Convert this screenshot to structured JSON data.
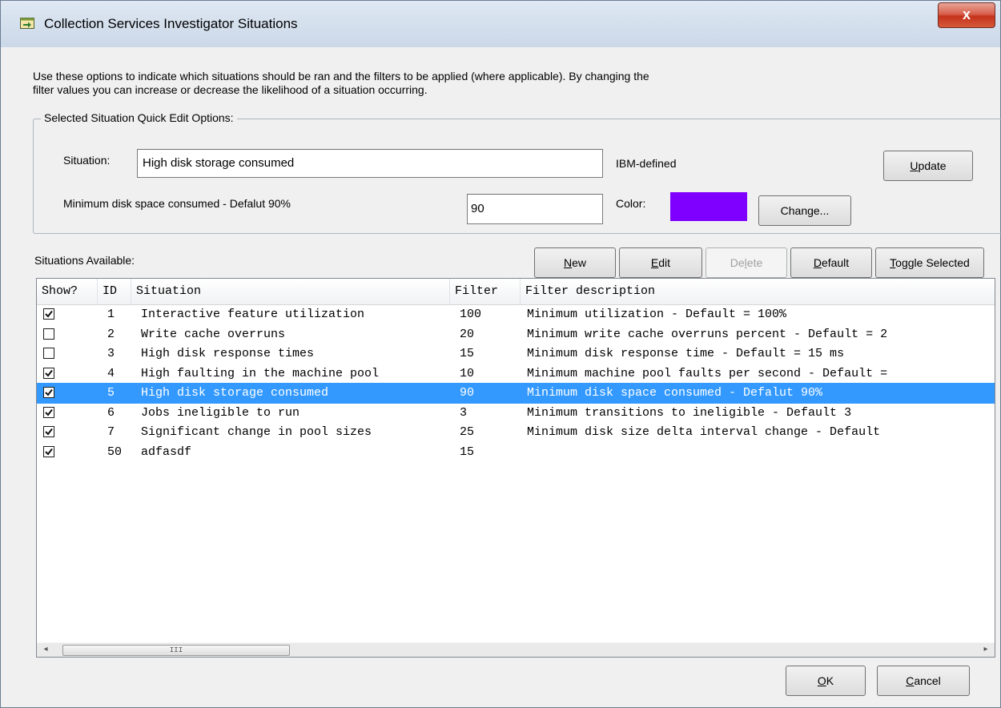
{
  "window": {
    "title": "Collection Services Investigator Situations",
    "close_label": "x"
  },
  "description_lines": [
    "Use these options to indicate which situations should be ran and the filters to be applied (where applicable).  By changing the",
    "filter values you can increase or decrease the likelihood of a situation occurring."
  ],
  "quick_edit": {
    "legend": "Selected Situation Quick Edit Options:",
    "situation_label": "Situation:",
    "situation_value": "High disk storage consumed",
    "defined_by": "IBM-defined",
    "update": {
      "pre": "",
      "accel": "U",
      "post": "pdate"
    },
    "filter_label": "Minimum disk space consumed - Defalut 90%",
    "filter_value": "90",
    "color_label": "Color:",
    "color_value": "#8000ff",
    "change_label": "Change..."
  },
  "list": {
    "label": "Situations Available:",
    "buttons": {
      "new": {
        "pre": "",
        "accel": "N",
        "post": "ew"
      },
      "edit": {
        "pre": "",
        "accel": "E",
        "post": "dit"
      },
      "delete": {
        "pre": "De",
        "accel": "l",
        "post": "ete"
      },
      "default": {
        "pre": "",
        "accel": "D",
        "post": "efault"
      },
      "toggle": {
        "pre": "",
        "accel": "T",
        "post": "oggle Selected"
      }
    },
    "columns": [
      "Show?",
      "ID",
      "Situation",
      "Filter",
      "Filter description"
    ],
    "rows": [
      {
        "show": true,
        "id": "1",
        "situation": "Interactive feature utilization",
        "filter": "100",
        "description": "Minimum utilization - Default = 100%"
      },
      {
        "show": false,
        "id": "2",
        "situation": "Write cache overruns",
        "filter": "20",
        "description": "Minimum write cache overruns percent - Default = 2"
      },
      {
        "show": false,
        "id": "3",
        "situation": "High disk response times",
        "filter": "15",
        "description": "Minimum disk response time - Default = 15 ms"
      },
      {
        "show": true,
        "id": "4",
        "situation": "High faulting in the machine pool",
        "filter": "10",
        "description": "Minimum machine pool faults per second - Default ="
      },
      {
        "show": true,
        "id": "5",
        "situation": "High disk storage consumed",
        "filter": "90",
        "description": "Minimum disk space consumed - Defalut 90%",
        "selected": true
      },
      {
        "show": true,
        "id": "6",
        "situation": "Jobs ineligible to run",
        "filter": "3",
        "description": "Minimum transitions to ineligible - Default 3"
      },
      {
        "show": true,
        "id": "7",
        "situation": "Significant change in pool sizes",
        "filter": "25",
        "description": "Minimum disk size delta interval change - Default"
      },
      {
        "show": true,
        "id": "50",
        "situation": "adfasdf",
        "filter": "15",
        "description": ""
      }
    ],
    "scroll": {
      "left": "◂",
      "right": "▸",
      "grip": "III"
    }
  },
  "footer": {
    "ok": {
      "pre": "",
      "accel": "O",
      "post": "K"
    },
    "cancel": {
      "pre": "",
      "accel": "C",
      "post": "ancel"
    }
  }
}
